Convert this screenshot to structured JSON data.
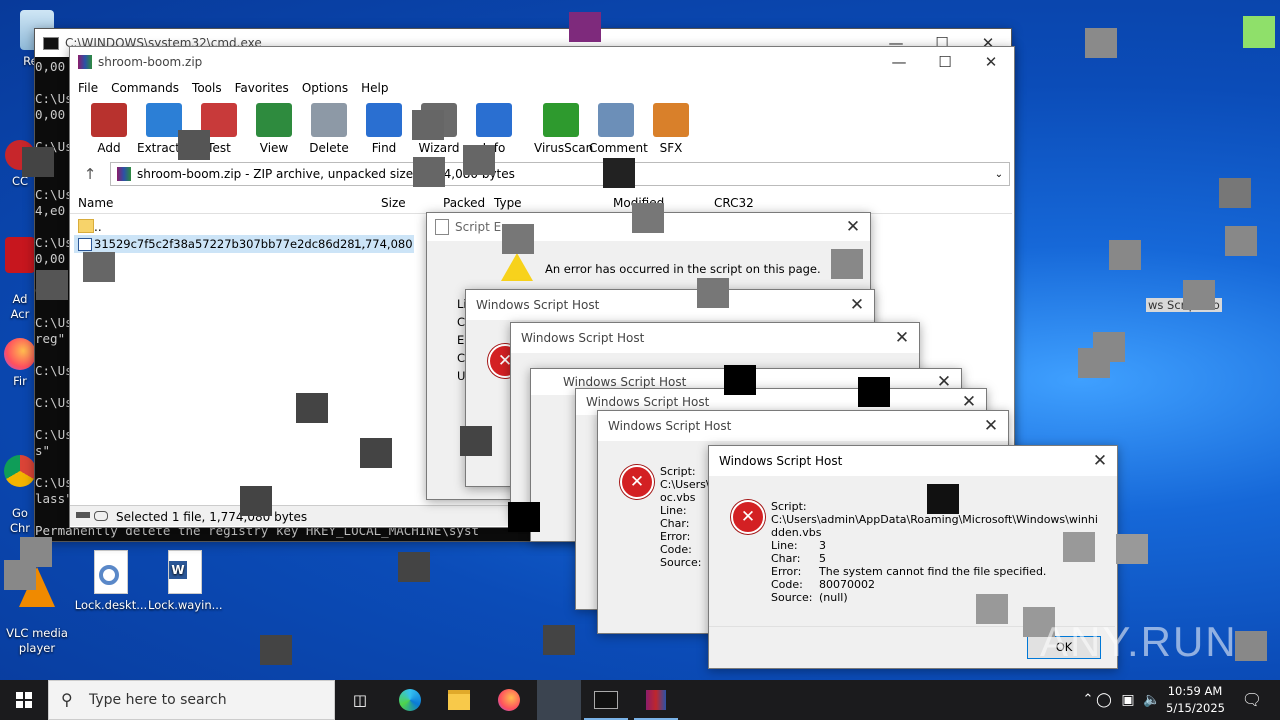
{
  "desktop_icons": [
    {
      "name": "recycle-bin-icon",
      "label": "Recy"
    },
    {
      "name": "cc-icon",
      "label": "CC"
    },
    {
      "name": "acrobat-icon",
      "label": "Ad\nAcr"
    },
    {
      "name": "firefox-icon",
      "label": "Fir"
    },
    {
      "name": "chrome-icon",
      "label": "Go\nChr"
    },
    {
      "name": "vlc-icon",
      "label": "VLC media\nplayer"
    },
    {
      "name": "lock-desktop-file-icon",
      "label": "Lock.deskt..."
    },
    {
      "name": "lock-word-file-icon",
      "label": "Lock.wayin..."
    }
  ],
  "cmd": {
    "title": "C:\\WINDOWS\\system32\\cmd.exe",
    "lines": [
      "0,00",
      "",
      "C:\\Us",
      "0,00",
      "",
      "C:\\Us",
      "c",
      "",
      "C:\\Us",
      "4,e0",
      "",
      "C:\\Us",
      "0,00",
      "",
      "0,00",
      "",
      "C:\\Us",
      "reg\"",
      "",
      "C:\\Us",
      "",
      "C:\\Us",
      "",
      "C:\\Us",
      "s\"",
      "",
      "C:\\Us",
      "lass\""
    ],
    "bottom_line": "Permanently delete the registry key HKEY_LOCAL_MACHINE\\syst"
  },
  "winrar": {
    "title": "shroom-boom.zip",
    "menu": [
      "File",
      "Commands",
      "Tools",
      "Favorites",
      "Options",
      "Help"
    ],
    "tools": [
      {
        "label": "Add",
        "color": "#b8322e"
      },
      {
        "label": "Extract To",
        "color": "#2c7fd6"
      },
      {
        "label": "Test",
        "color": "#c83a3a"
      },
      {
        "label": "View",
        "color": "#2e8b3e"
      },
      {
        "label": "Delete",
        "color": "#8d99a6"
      },
      {
        "label": "Find",
        "color": "#2a6fd1"
      },
      {
        "label": "Wizard",
        "color": "#6a6a6a"
      },
      {
        "label": "Info",
        "color": "#2a6fd1"
      },
      {
        "label": "VirusScan",
        "color": "#2e9a2e"
      },
      {
        "label": "Comment",
        "color": "#6c8fb8"
      },
      {
        "label": "SFX",
        "color": "#d9802a"
      }
    ],
    "path": "shroom-boom.zip - ZIP archive, unpacked size 1,774,080 bytes",
    "columns": [
      "Name",
      "Size",
      "Packed",
      "Type",
      "Modified",
      "CRC32"
    ],
    "rows": [
      {
        "name": "..",
        "size": ""
      },
      {
        "name": "31529c7f5c2f38a57227b307bb77e2dc86d28...",
        "size": "1,774,080"
      }
    ],
    "status": "Selected 1 file, 1,774,080 bytes"
  },
  "script_error": {
    "title": "Script Error",
    "message": "An error has occurred in the script on this page.",
    "labels": [
      "Li",
      "Ch",
      "Er",
      "Co",
      "UI"
    ]
  },
  "wsh_title": "Windows Script Host",
  "mid_dialog": {
    "label_script": "Script:",
    "path_partial": "C:\\Users\\a",
    "path_tail": "oc.vbs",
    "labels": [
      "Line:",
      "Char:",
      "Error:",
      "Code:",
      "Source:"
    ]
  },
  "main_dialog": {
    "title": "Windows Script Host",
    "script_label": "Script:",
    "script_path_1": "C:\\Users\\admin\\AppData\\Roaming\\Microsoft\\Windows\\winhi",
    "script_path_2": "dden.vbs",
    "fields": [
      {
        "label": "Line:",
        "value": "3"
      },
      {
        "label": "Char:",
        "value": "5"
      },
      {
        "label": "Error:",
        "value": "The system cannot find the file specified."
      },
      {
        "label": "Code:",
        "value": "80070002"
      },
      {
        "label": "Source:",
        "value": "(null)"
      }
    ],
    "ok": "OK"
  },
  "ghost_wsh": "ws Script Ho",
  "watermark": "ANY.RUN",
  "taskbar": {
    "search_placeholder": "Type here to search",
    "time": "10:59 AM",
    "date": "5/15/2025"
  }
}
